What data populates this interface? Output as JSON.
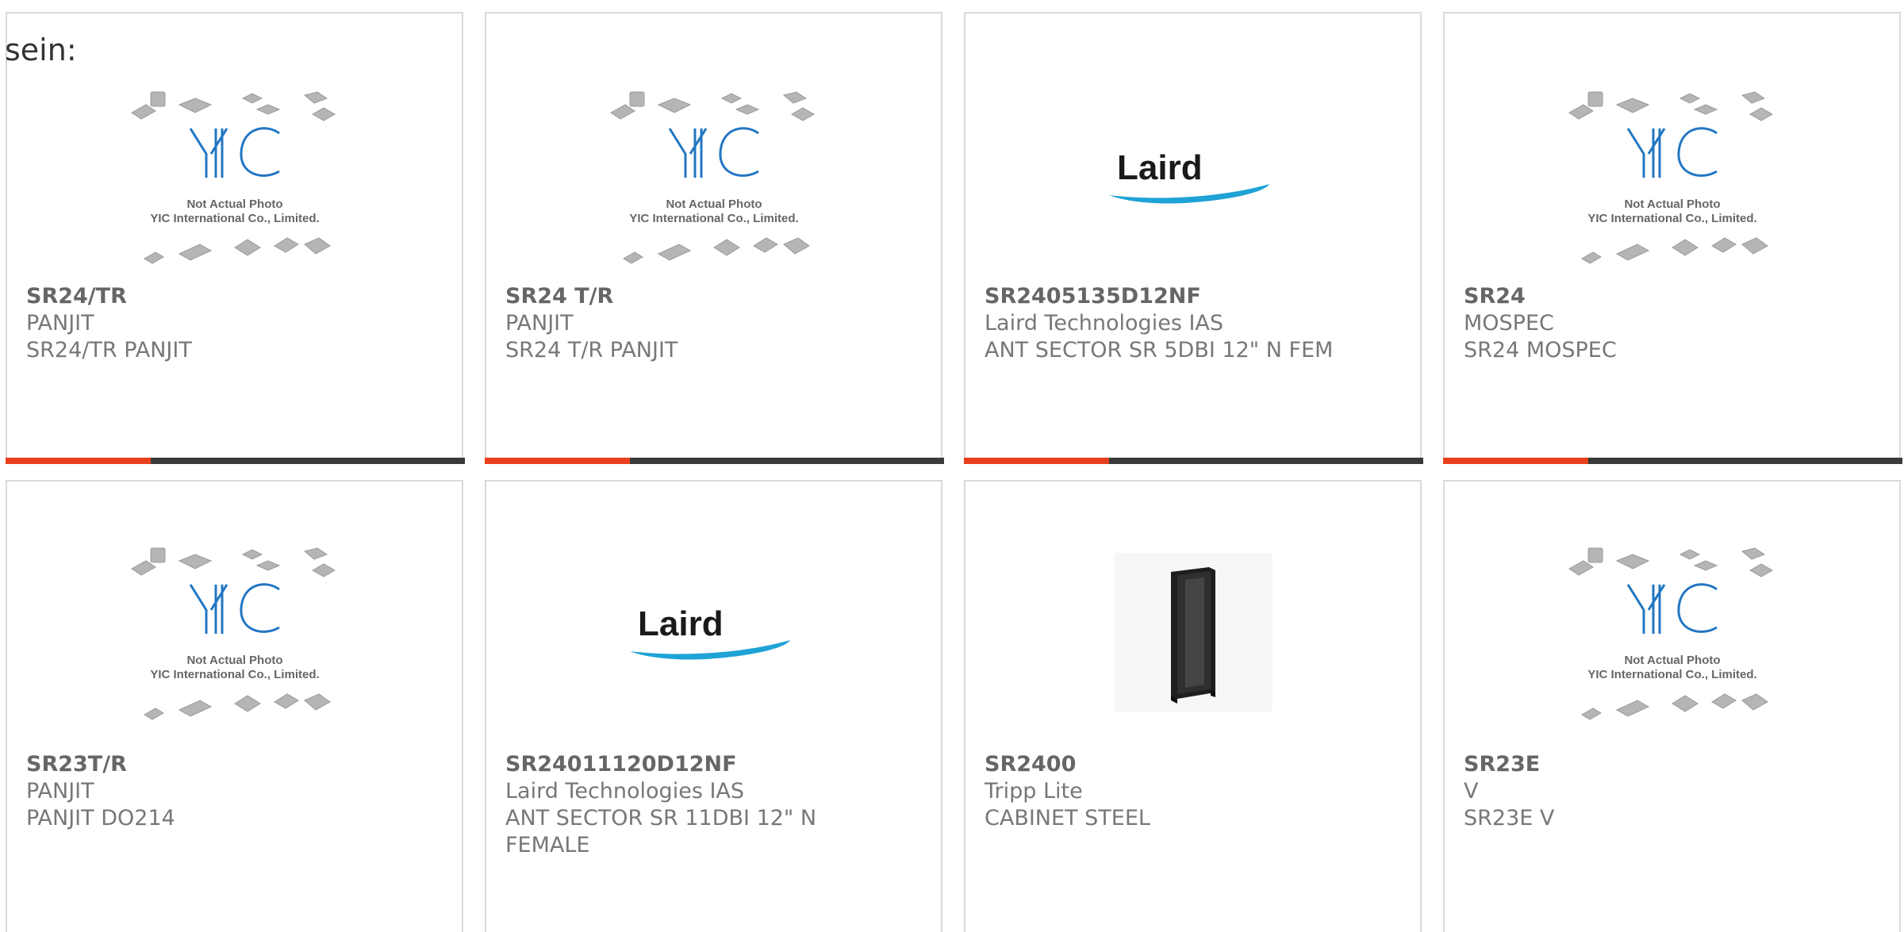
{
  "colors": {
    "accent": "#e8401c",
    "bar_dark": "#3a3a3a",
    "card_border": "#dadada",
    "part_number_text": "#666666",
    "body_text": "#777777",
    "yic_blue": "#2276c2",
    "laird_blue": "#1fa3d6"
  },
  "header": {
    "partial_label": "sein:"
  },
  "placeholder_image": {
    "brand": "YIC",
    "caption_line1": "Not Actual Photo",
    "caption_line2": "YIC International Co., Limited."
  },
  "laird_logo": {
    "text": "Laird"
  },
  "products": [
    {
      "part": "SR24/TR",
      "manufacturer": "PANJIT",
      "description": [
        "SR24/TR PANJIT"
      ],
      "image": "yic-placeholder"
    },
    {
      "part": "SR24 T/R",
      "manufacturer": "PANJIT",
      "description": [
        "SR24 T/R PANJIT"
      ],
      "image": "yic-placeholder"
    },
    {
      "part": "SR2405135D12NF",
      "manufacturer": "Laird Technologies IAS",
      "description": [
        "ANT SECTOR SR 5DBI 12\" N FEM"
      ],
      "image": "laird-logo"
    },
    {
      "part": "SR24",
      "manufacturer": "MOSPEC",
      "description": [
        "SR24 MOSPEC"
      ],
      "image": "yic-placeholder"
    },
    {
      "part": "SR23T/R",
      "manufacturer": "PANJIT",
      "description": [
        "PANJIT DO214"
      ],
      "image": "yic-placeholder"
    },
    {
      "part": "SR24011120D12NF",
      "manufacturer": "Laird Technologies IAS",
      "description": [
        "ANT SECTOR SR 11DBI 12\" N",
        "FEMALE"
      ],
      "image": "laird-logo"
    },
    {
      "part": "SR2400",
      "manufacturer": "Tripp Lite",
      "description": [
        "CABINET STEEL"
      ],
      "image": "server-cabinet-photo"
    },
    {
      "part": "SR23E",
      "manufacturer": "V",
      "description": [
        "SR23E V"
      ],
      "image": "yic-placeholder"
    }
  ]
}
